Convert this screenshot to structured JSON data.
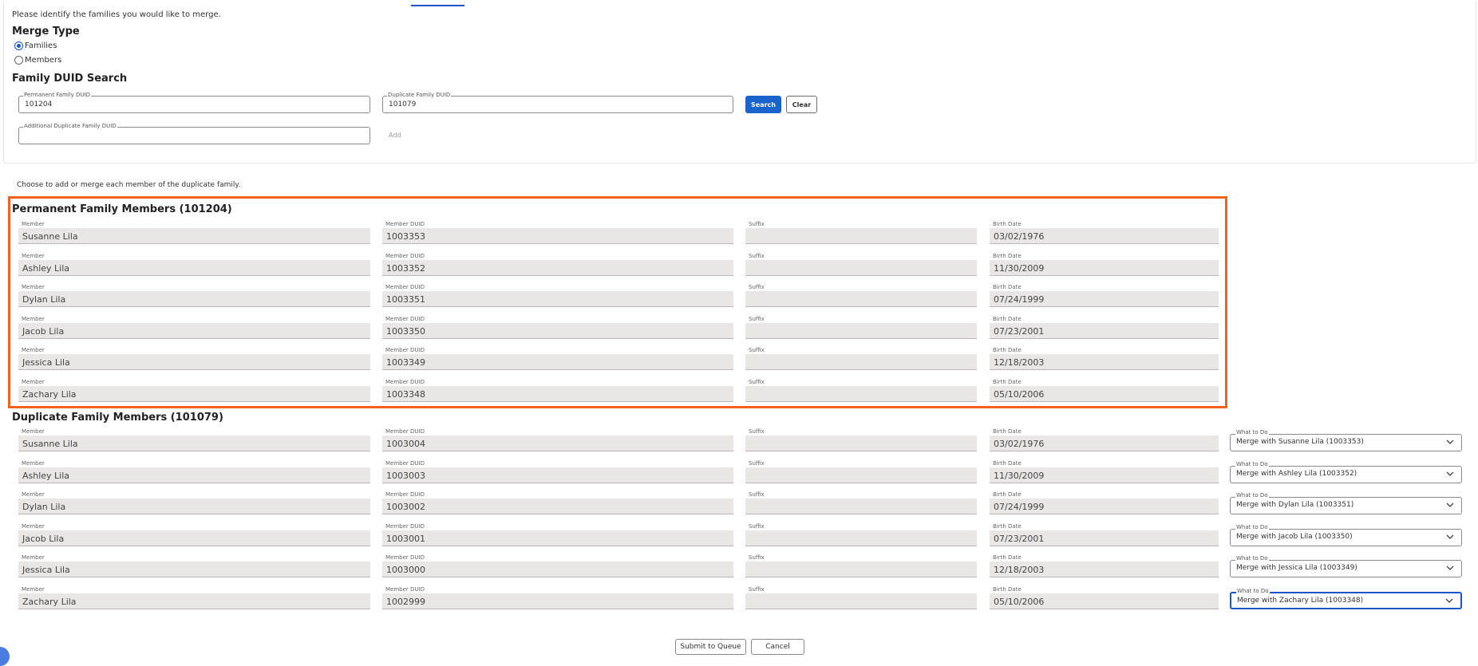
{
  "intro_text": "Please identify the families you would like to merge.",
  "merge_type": {
    "title": "Merge Type",
    "options": [
      {
        "label": "Families",
        "selected": true
      },
      {
        "label": "Members",
        "selected": false
      }
    ]
  },
  "search": {
    "title": "Family DUID Search",
    "permanent_label": "Permanent Family DUID",
    "permanent_value": "101204",
    "duplicate_label": "Duplicate Family DUID",
    "duplicate_value": "101079",
    "additional_label": "Additional Duplicate Family DUID",
    "additional_value": "",
    "search_button": "Search",
    "clear_button": "Clear",
    "add_button": "Add"
  },
  "choose_text": "Choose to add or merge each member of the duplicate family.",
  "labels": {
    "member": "Member",
    "member_duid": "Member DUID",
    "suffix": "Suffix",
    "birth_date": "Birth Date",
    "what_to_do": "What to Do"
  },
  "permanent_section": {
    "title": "Permanent Family Members (101204)",
    "rows": [
      {
        "member": "Susanne Lila",
        "duid": "1003353",
        "suffix": "",
        "birth": "03/02/1976"
      },
      {
        "member": "Ashley Lila",
        "duid": "1003352",
        "suffix": "",
        "birth": "11/30/2009"
      },
      {
        "member": "Dylan Lila",
        "duid": "1003351",
        "suffix": "",
        "birth": "07/24/1999"
      },
      {
        "member": "Jacob Lila",
        "duid": "1003350",
        "suffix": "",
        "birth": "07/23/2001"
      },
      {
        "member": "Jessica Lila",
        "duid": "1003349",
        "suffix": "",
        "birth": "12/18/2003"
      },
      {
        "member": "Zachary Lila",
        "duid": "1003348",
        "suffix": "",
        "birth": "05/10/2006"
      }
    ]
  },
  "duplicate_section": {
    "title": "Duplicate Family Members (101079)",
    "rows": [
      {
        "member": "Susanne Lila",
        "duid": "1003004",
        "suffix": "",
        "birth": "03/02/1976",
        "action": "Merge with Susanne Lila (1003353)"
      },
      {
        "member": "Ashley Lila",
        "duid": "1003003",
        "suffix": "",
        "birth": "11/30/2009",
        "action": "Merge with Ashley Lila (1003352)"
      },
      {
        "member": "Dylan Lila",
        "duid": "1003002",
        "suffix": "",
        "birth": "07/24/1999",
        "action": "Merge with Dylan Lila (1003351)"
      },
      {
        "member": "Jacob Lila",
        "duid": "1003001",
        "suffix": "",
        "birth": "07/23/2001",
        "action": "Merge with Jacob Lila (1003350)"
      },
      {
        "member": "Jessica Lila",
        "duid": "1003000",
        "suffix": "",
        "birth": "12/18/2003",
        "action": "Merge with Jessica Lila (1003349)"
      },
      {
        "member": "Zachary Lila",
        "duid": "1002999",
        "suffix": "",
        "birth": "05/10/2006",
        "action": "Merge with Zachary Lila (1003348)"
      }
    ]
  },
  "footer": {
    "submit_button": "Submit to Queue",
    "cancel_button": "Cancel"
  },
  "colors": {
    "accent": "#1a62cc",
    "highlight_border": "#f0621e",
    "readonly_field": "#e9e6e6"
  },
  "icons": {
    "dropdown": "chevron-down-icon",
    "help": "help-bubble-icon"
  }
}
